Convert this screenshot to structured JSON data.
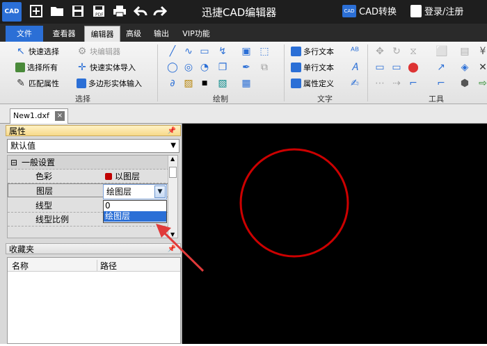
{
  "app": {
    "title": "迅捷CAD编辑器",
    "logo_text": "CAD",
    "convert_label": "CAD转换",
    "login_label": "登录/注册"
  },
  "menu": {
    "tabs": [
      {
        "label": "文件",
        "active": false
      },
      {
        "label": "查看器",
        "active": false
      },
      {
        "label": "编辑器",
        "active": true
      },
      {
        "label": "高级",
        "active": false
      },
      {
        "label": "输出",
        "active": false
      },
      {
        "label": "VIP功能",
        "active": false
      }
    ]
  },
  "ribbon": {
    "select_group": {
      "label": "选择",
      "buttons": [
        "快速选择",
        "块编辑器",
        "选择所有",
        "快速实体导入",
        "匹配属性",
        "多边形实体输入"
      ]
    },
    "draw_group": {
      "label": "绘制"
    },
    "text_group": {
      "label": "文字",
      "buttons": [
        "多行文本",
        "单行文本",
        "属性定义"
      ]
    },
    "tools_group": {
      "label": "工具"
    }
  },
  "document": {
    "tab_label": "New1.dxf",
    "close": "×"
  },
  "properties": {
    "header": "属性",
    "selector_value": "默认值",
    "section_title": "一般设置",
    "rows": [
      {
        "key": "色彩",
        "value": "以图层",
        "swatch": "#c00000"
      },
      {
        "key": "图层",
        "value": "绘图层"
      },
      {
        "key": "线型",
        "value": ""
      },
      {
        "key": "线型比例",
        "value": ""
      }
    ],
    "layer_options": [
      "0",
      "绘图层"
    ],
    "selected_option": "绘图层"
  },
  "favorites": {
    "header": "收藏夹",
    "columns": [
      "名称",
      "路径"
    ]
  },
  "colors": {
    "accent": "#2b6fd6",
    "circle": "#cc0000",
    "arrow": "#e03a3a",
    "canvas": "#000000"
  },
  "icons": [
    "new-file-icon",
    "open-folder-icon",
    "save-icon",
    "save-as-icon",
    "print-icon",
    "undo-icon",
    "redo-icon",
    "user-icon",
    "pin-icon"
  ]
}
